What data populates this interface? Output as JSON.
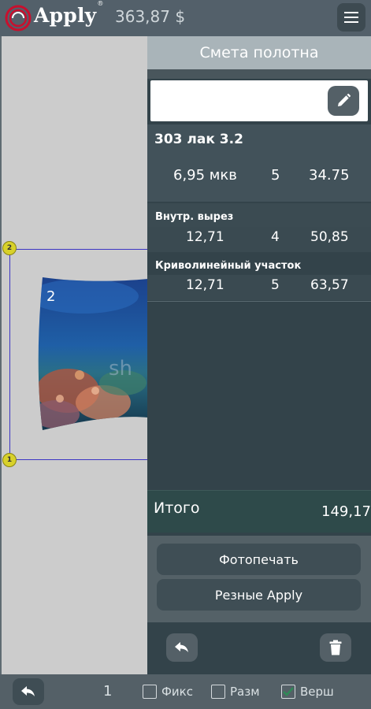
{
  "topbar": {
    "brand": "Apply",
    "brand_mark": "®",
    "price": "363,87 $"
  },
  "canvas": {
    "piece_number": "2",
    "handle_top": "2",
    "handle_bottom": "1",
    "watermark": "sh"
  },
  "panel": {
    "title": "Смета полотна",
    "name_value": "",
    "material": {
      "name": "303 лак 3.2",
      "area": "6,95 мкв",
      "quantity": "5",
      "sum": "34.75"
    },
    "items": [
      {
        "title": "Внутр. вырез",
        "length": "12,71",
        "price": "4",
        "sum": "50,85"
      },
      {
        "title": "Криволинейный участок",
        "length": "12,71",
        "price": "5",
        "sum": "63,57"
      }
    ],
    "total_label": "Итого",
    "total_value": "149,17",
    "buttons": {
      "photo_print": "Фотопечать",
      "carved_apply": "Резные Apply"
    }
  },
  "bottombar": {
    "page": "1",
    "checkboxes": [
      {
        "label": "Фикс",
        "checked": false
      },
      {
        "label": "Разм",
        "checked": false
      },
      {
        "label": "Верш",
        "checked": true
      }
    ]
  },
  "colors": {
    "logo_red": "#c8102e",
    "handle_yellow": "#d8d12a",
    "selection_blue": "#3b35c4",
    "check_green": "#2e8b57"
  }
}
